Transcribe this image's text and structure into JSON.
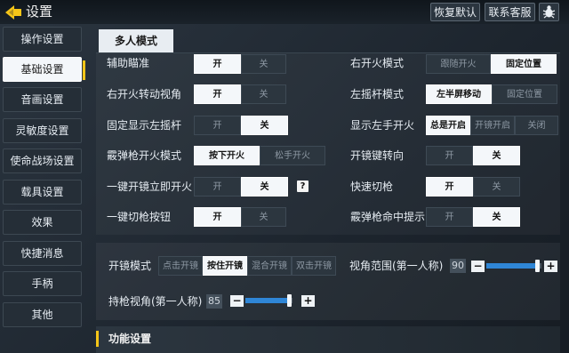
{
  "header": {
    "title": "设置",
    "restore_default": "恢复默认",
    "contact_support": "联系客服"
  },
  "sidebar": {
    "items": [
      {
        "label": "操作设置",
        "active": false
      },
      {
        "label": "基础设置",
        "active": true
      },
      {
        "label": "音画设置",
        "active": false
      },
      {
        "label": "灵敏度设置",
        "active": false
      },
      {
        "label": "使命战场设置",
        "active": false
      },
      {
        "label": "载具设置",
        "active": false
      },
      {
        "label": "效果",
        "active": false
      },
      {
        "label": "快捷消息",
        "active": false
      },
      {
        "label": "手柄",
        "active": false
      },
      {
        "label": "其他",
        "active": false
      }
    ]
  },
  "tab": {
    "label": "多人模式"
  },
  "settings": {
    "aim_assist": {
      "label": "辅助瞄准",
      "options": [
        "开",
        "关"
      ],
      "selected": 0
    },
    "right_fire_rotate_view": {
      "label": "右开火转动视角",
      "options": [
        "开",
        "关"
      ],
      "selected": 0
    },
    "fixed_left_joystick": {
      "label": "固定显示左摇杆",
      "options": [
        "开",
        "关"
      ],
      "selected": 1
    },
    "shotgun_fire_mode": {
      "label": "霰弹枪开火模式",
      "options": [
        "按下开火",
        "松手开火"
      ],
      "selected": 0
    },
    "scope_instant_fire": {
      "label": "一键开镜立即开火",
      "options": [
        "开",
        "关"
      ],
      "selected": 1,
      "help": "?"
    },
    "one_key_switch_gun": {
      "label": "一键切枪按钮",
      "options": [
        "开",
        "关"
      ],
      "selected": 0
    },
    "right_fire_mode": {
      "label": "右开火模式",
      "options": [
        "跟随开火",
        "固定位置"
      ],
      "selected": 1
    },
    "left_joystick_mode": {
      "label": "左摇杆模式",
      "options": [
        "左半屏移动",
        "固定位置"
      ],
      "selected": 0
    },
    "show_left_fire": {
      "label": "显示左手开火",
      "options": [
        "总是开启",
        "开镜开启",
        "关闭"
      ],
      "selected": 0
    },
    "scope_key_turn": {
      "label": "开镜键转向",
      "options": [
        "开",
        "关"
      ],
      "selected": 1
    },
    "quick_switch_gun": {
      "label": "快速切枪",
      "options": [
        "开",
        "关"
      ],
      "selected": 0
    },
    "shotgun_hit_hint": {
      "label": "霰弹枪命中提示",
      "options": [
        "开",
        "关"
      ],
      "selected": 1
    }
  },
  "scope": {
    "mode_label": "开镜模式",
    "mode_options": [
      "点击开镜",
      "按住开镜",
      "混合开镜",
      "双击开镜"
    ],
    "mode_selected": 1,
    "fov_label": "视角范围(第一人称)",
    "fov_value": "90",
    "fov_level": 0.92,
    "gun_view_label": "持枪视角(第一人称)",
    "gun_view_value": "85",
    "gun_view_level": 0.92,
    "minus": "−",
    "plus": "+"
  },
  "function_section": {
    "title": "功能设置"
  },
  "colors": {
    "accent": "#f5c518",
    "slider": "#2f86d6",
    "selected_bg": "#f4f7fa"
  }
}
